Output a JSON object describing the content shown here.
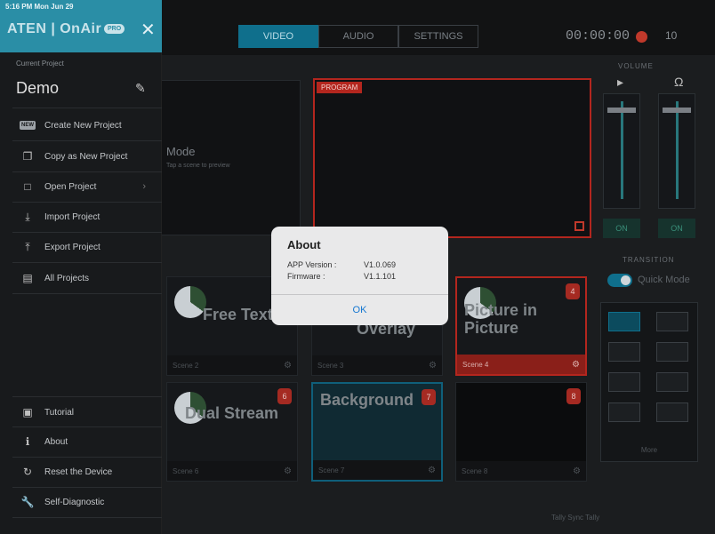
{
  "statusbar": {
    "time": "5:16 PM  Mon Jun 29"
  },
  "brand": {
    "name": "ATEN | OnAir",
    "badge": "PRO"
  },
  "main": {
    "tabs": [
      "VIDEO",
      "AUDIO",
      "SETTINGS"
    ],
    "timer": "00:00:00",
    "rec_count": "10",
    "preview_mode": "Mode",
    "preview_hint": "Tap a scene to preview",
    "program_label": "PROGRAM",
    "volume_title": "VOLUME",
    "on_label": "ON",
    "transition_title": "TRANSITION",
    "quick_mode": "Quick Mode",
    "more_label": "More",
    "bottom_labels": "Tally Sync   Tally"
  },
  "scenes": [
    {
      "title": "Free Text",
      "label": "Scene 2",
      "badge": ""
    },
    {
      "title": "Overlay",
      "label": "Scene 3",
      "badge": ""
    },
    {
      "title": "Picture in Picture",
      "label": "Scene 4",
      "badge": "4"
    },
    {
      "title": "Dual Stream",
      "label": "Scene 6",
      "badge": "6"
    },
    {
      "title": "Background",
      "label": "Scene 7",
      "badge": "7"
    },
    {
      "title": "",
      "label": "Scene 8",
      "badge": "8"
    }
  ],
  "sidebar": {
    "current_project_label": "Current Project",
    "project_name": "Demo",
    "items": [
      {
        "label": "Create New Project"
      },
      {
        "label": "Copy as New Project"
      },
      {
        "label": "Open Project"
      },
      {
        "label": "Import Project"
      },
      {
        "label": "Export Project"
      },
      {
        "label": "All Projects"
      }
    ],
    "bottom_items": [
      {
        "label": "Tutorial"
      },
      {
        "label": "About"
      },
      {
        "label": "Reset the Device"
      },
      {
        "label": "Self-Diagnostic"
      }
    ]
  },
  "about": {
    "title": "About",
    "app_version_label": "APP Version :",
    "app_version": "V1.0.069",
    "firmware_label": "Firmware :",
    "firmware": "V1.1.101",
    "ok": "OK"
  }
}
